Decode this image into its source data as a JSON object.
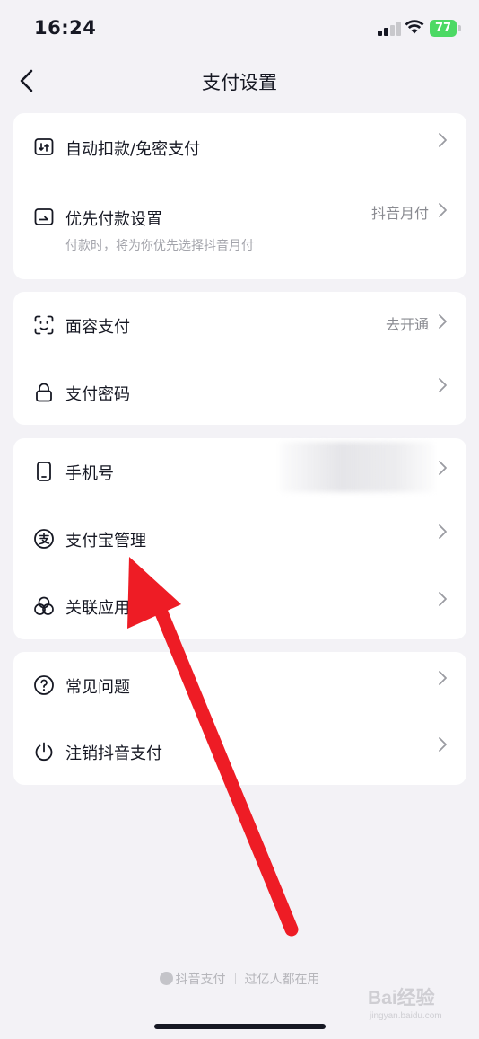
{
  "status_bar": {
    "time": "16:24",
    "battery": "77"
  },
  "header": {
    "title": "支付设置"
  },
  "groups": [
    {
      "items": [
        {
          "label": "自动扣款/免密支付",
          "icon": "auto-pay-icon"
        },
        {
          "label": "优先付款设置",
          "value": "抖音月付",
          "sub": "付款时，将为你优先选择抖音月付",
          "icon": "priority-pay-icon"
        }
      ]
    },
    {
      "items": [
        {
          "label": "面容支付",
          "value": "去开通",
          "icon": "face-id-icon"
        },
        {
          "label": "支付密码",
          "icon": "lock-icon"
        }
      ]
    },
    {
      "items": [
        {
          "label": "手机号",
          "icon": "phone-icon"
        },
        {
          "label": "支付宝管理",
          "icon": "alipay-icon"
        },
        {
          "label": "关联应用",
          "icon": "linked-apps-icon"
        }
      ]
    },
    {
      "items": [
        {
          "label": "常见问题",
          "icon": "question-icon"
        },
        {
          "label": "注销抖音支付",
          "icon": "power-icon"
        }
      ]
    }
  ],
  "footer": {
    "brand": "抖音支付",
    "slogan": "过亿人都在用"
  },
  "watermark": {
    "text": "Bai经验",
    "sub": "jingyan.baidu.com"
  },
  "colors": {
    "background": "#f3f2f6",
    "card": "#ffffff",
    "text": "#161823",
    "secondary": "#8a8b91",
    "arrow": "#ee1c25"
  }
}
